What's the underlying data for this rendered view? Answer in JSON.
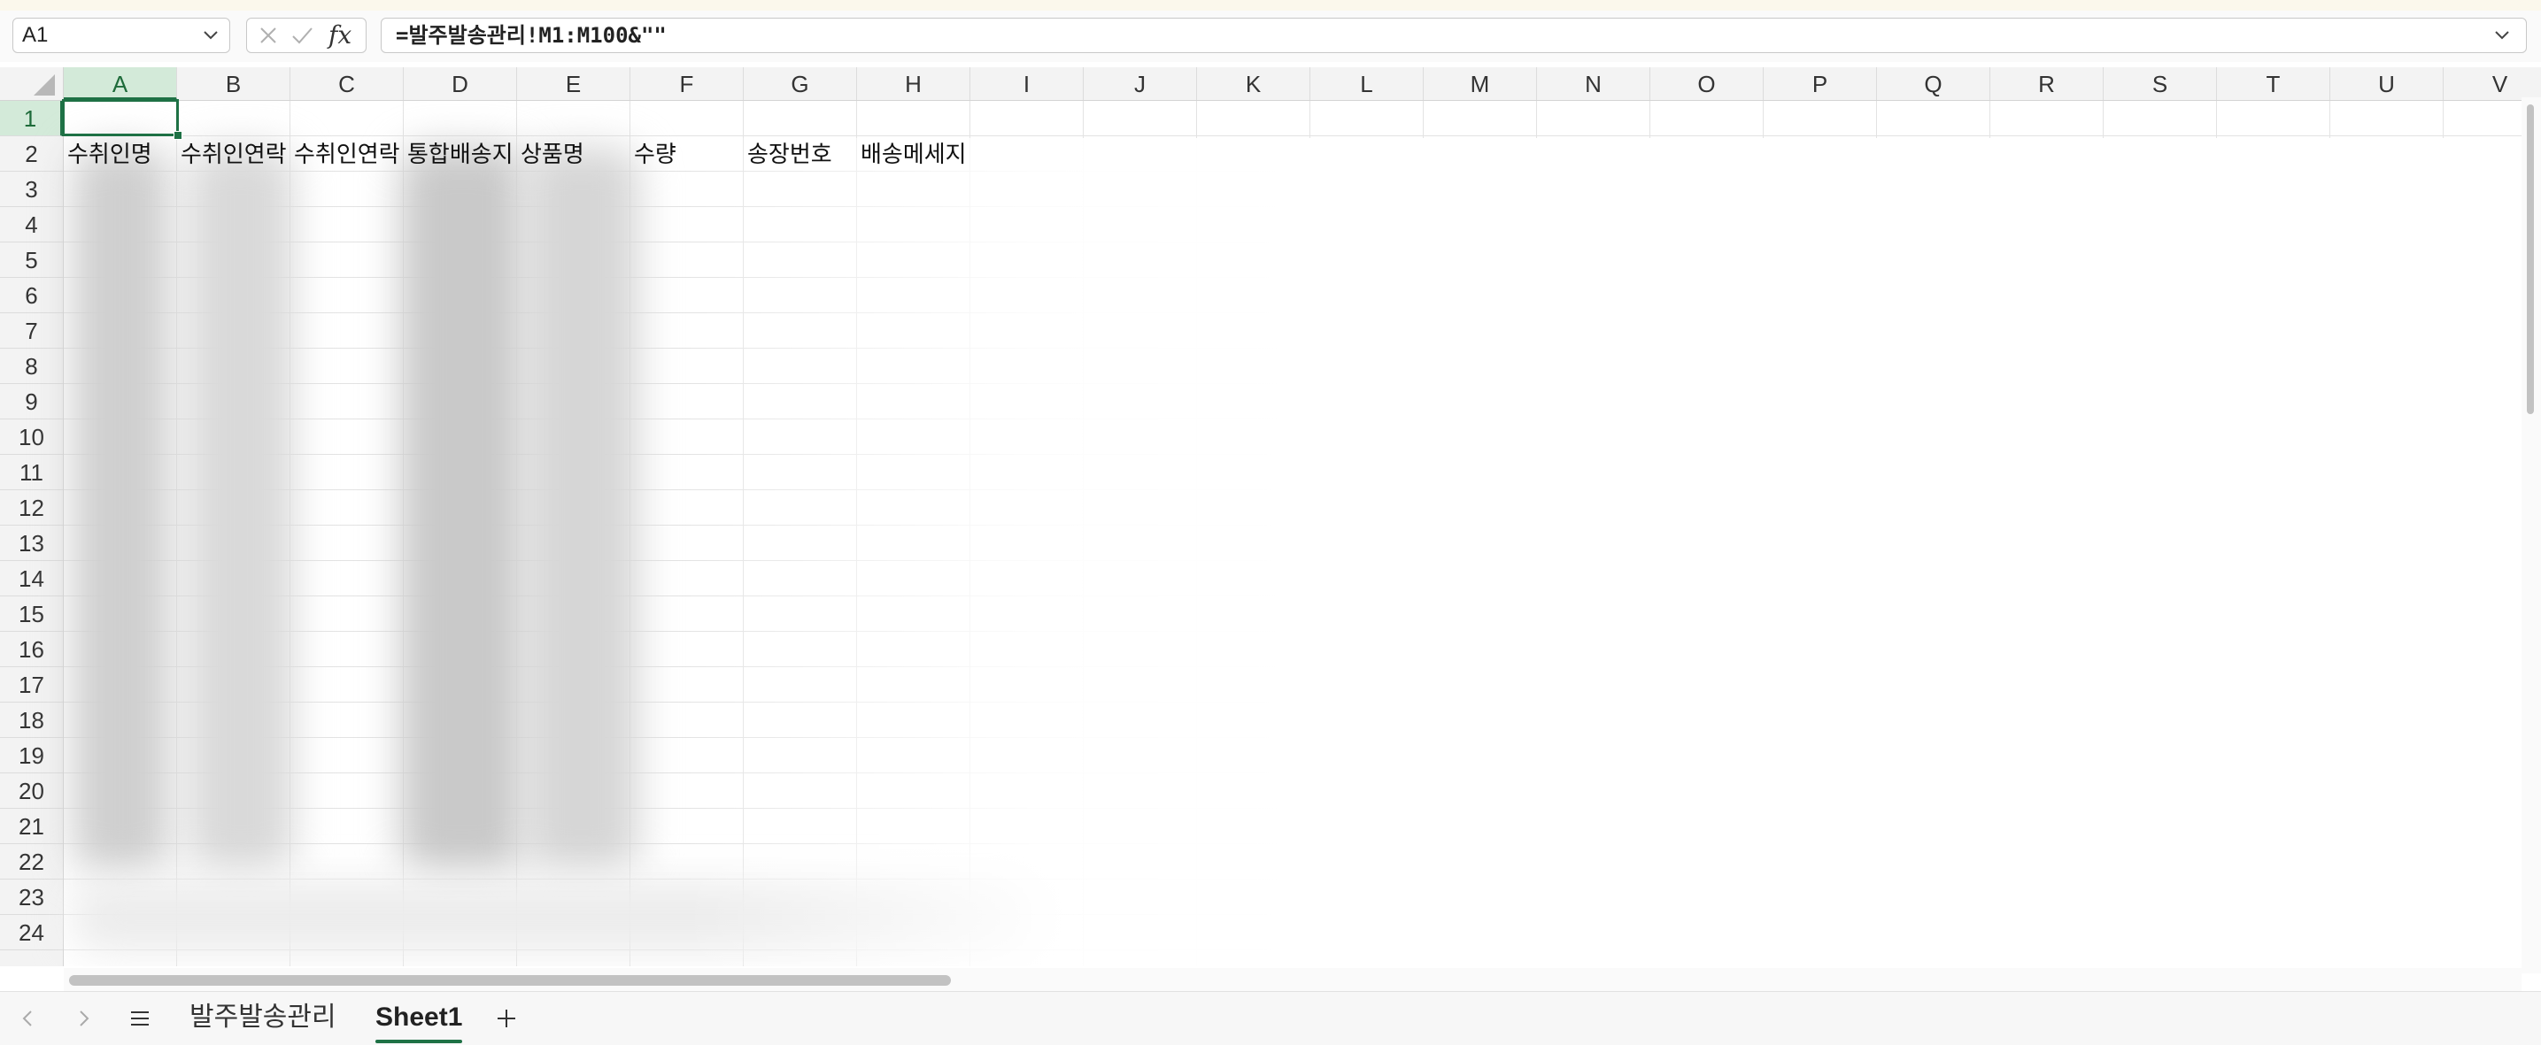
{
  "formula_bar": {
    "name_box": "A1",
    "formula": "=발주발송관리!M1:M100&\"\"",
    "fx_label": "fx"
  },
  "columns": [
    "A",
    "B",
    "C",
    "D",
    "E",
    "F",
    "G",
    "H",
    "I",
    "J",
    "K",
    "L",
    "M",
    "N",
    "O",
    "P",
    "Q",
    "R",
    "S",
    "T",
    "U",
    "V"
  ],
  "rows": [
    "1",
    "2",
    "3",
    "4",
    "5",
    "6",
    "7",
    "8",
    "9",
    "10",
    "11",
    "12",
    "13",
    "14",
    "15",
    "16",
    "17",
    "18",
    "19",
    "20",
    "21",
    "22",
    "23",
    "24"
  ],
  "selected_cell": "A1",
  "cells": {
    "A2": "수취인명",
    "B2": "수취인연락",
    "C2": "수취인연락",
    "D2": "통합배송지",
    "E2": "상품명",
    "F2": "수량",
    "G2": "송장번호",
    "H2": "배송메세지"
  },
  "sheet_tabs": {
    "tabs": [
      "발주발송관리",
      "Sheet1"
    ],
    "active": "Sheet1"
  }
}
